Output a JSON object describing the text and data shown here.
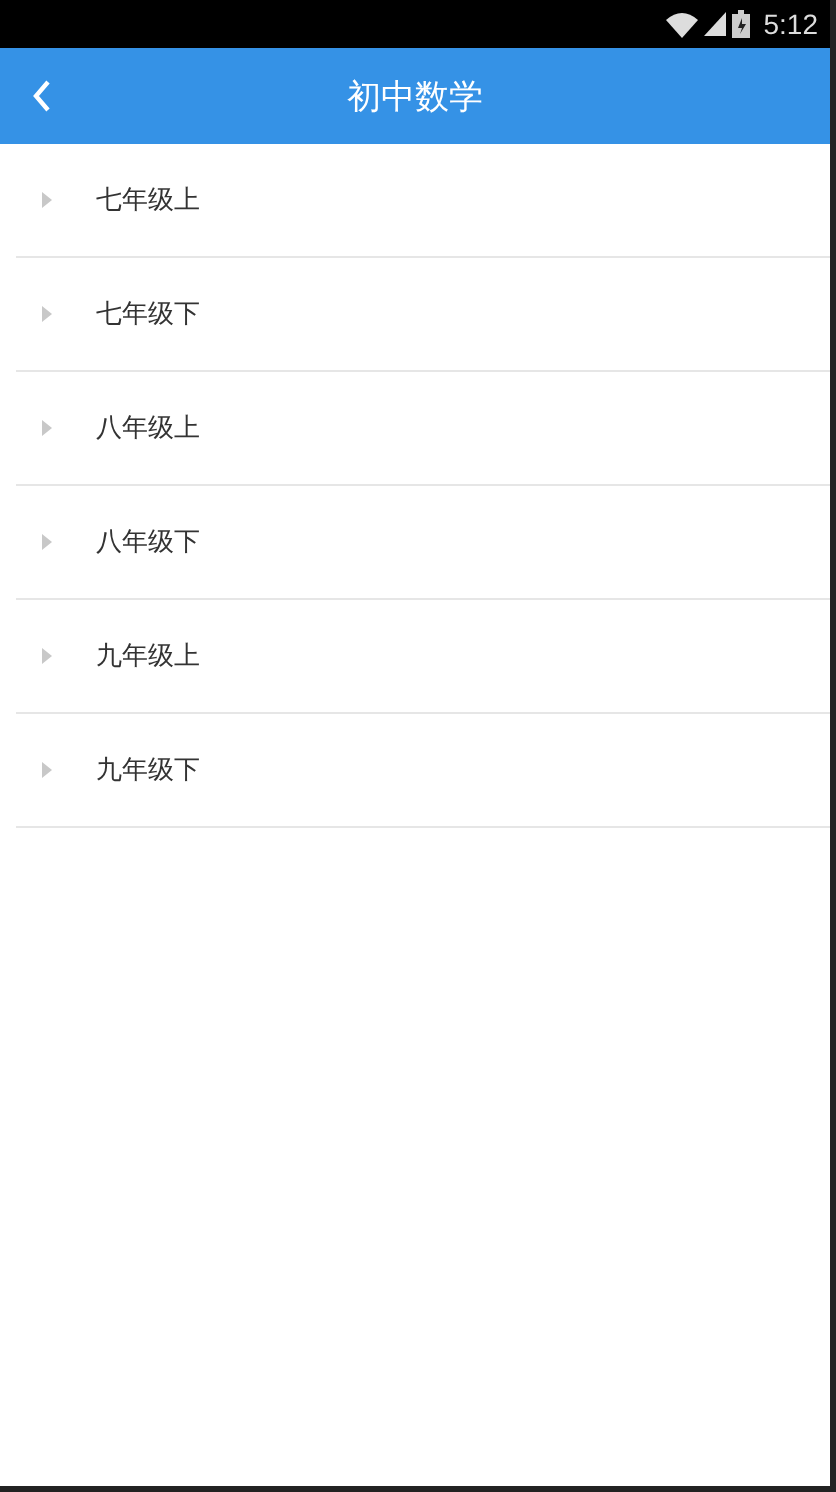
{
  "status_bar": {
    "time": "5:12"
  },
  "header": {
    "title": "初中数学"
  },
  "items": [
    {
      "label": "七年级上",
      "expanded": false
    },
    {
      "label": "七年级下",
      "expanded": false
    },
    {
      "label": "八年级上",
      "expanded": false
    },
    {
      "label": "八年级下",
      "expanded": false
    },
    {
      "label": "九年级上",
      "expanded": false
    },
    {
      "label": "九年级下",
      "expanded": false
    }
  ]
}
